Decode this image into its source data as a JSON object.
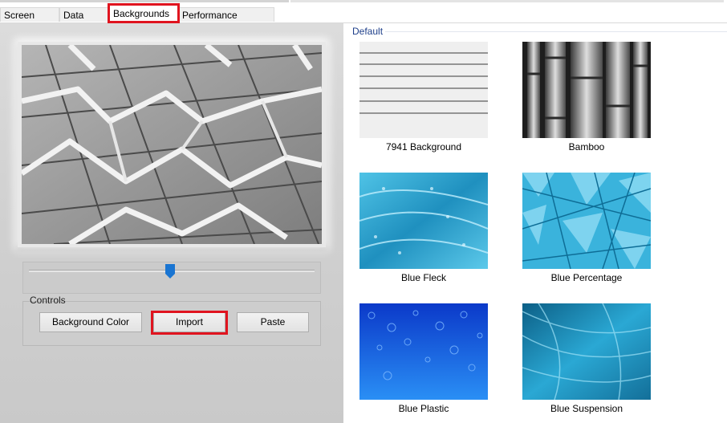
{
  "tabs": [
    {
      "label": "Screen View"
    },
    {
      "label": "Data View"
    },
    {
      "label": "Backgrounds"
    },
    {
      "label": "Performance Monitor"
    }
  ],
  "active_tab": "Backgrounds",
  "preview": {
    "image": "Pavement pattern (grayscale)"
  },
  "slider": {
    "value": 0.5
  },
  "controls": {
    "group_label": "Controls",
    "background_color_button": "Background Color",
    "import_button": "Import",
    "paste_button": "Paste"
  },
  "gallery": {
    "group_label": "Default",
    "items": [
      {
        "label": "7941 Background"
      },
      {
        "label": "Bamboo"
      },
      {
        "label": "Blue Fleck"
      },
      {
        "label": "Blue Percentage"
      },
      {
        "label": "Blue Plastic"
      },
      {
        "label": "Blue Suspension"
      }
    ]
  },
  "colors": {
    "highlight": "#e0141f",
    "accent_blue": "#1e3f8a",
    "slider_thumb": "#1a75d2"
  }
}
